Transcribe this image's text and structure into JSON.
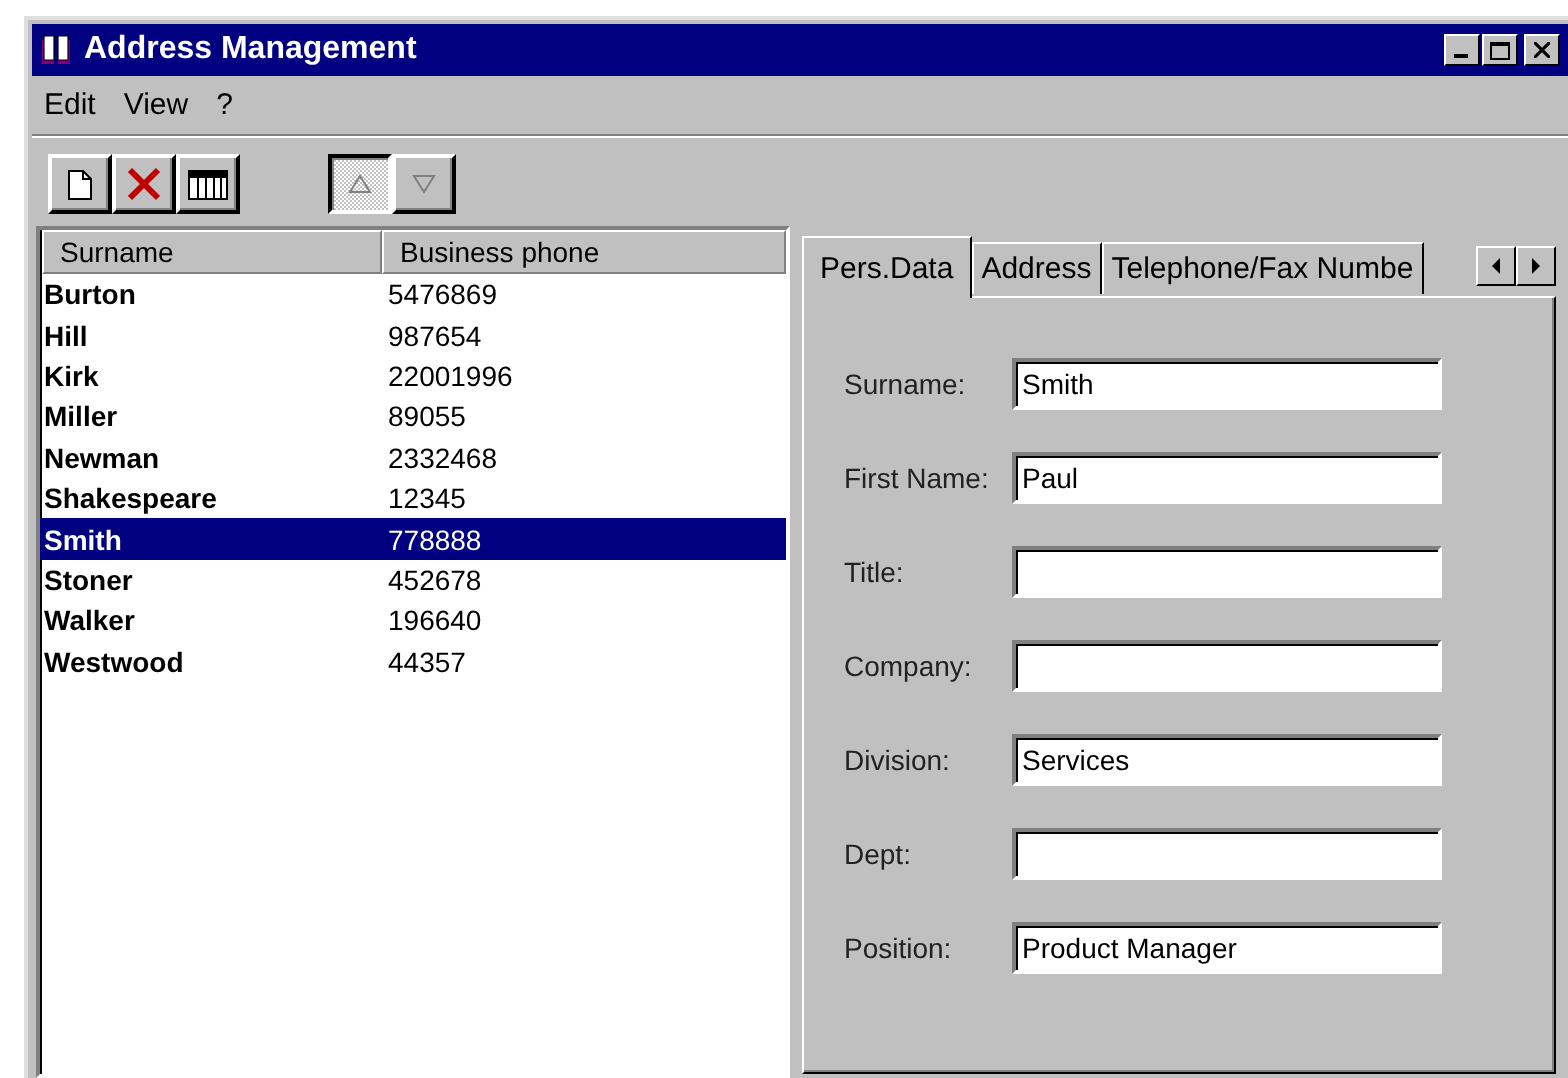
{
  "window": {
    "title": "Address Management"
  },
  "menu": [
    {
      "label": "Edit"
    },
    {
      "label": "View"
    },
    {
      "label": "?"
    }
  ],
  "toolbar": [
    {
      "kind": "new",
      "pressed": false,
      "disabled": false
    },
    {
      "kind": "delete",
      "pressed": false,
      "disabled": false
    },
    {
      "kind": "columns",
      "pressed": false,
      "disabled": false
    },
    {
      "kind": "sort-up",
      "pressed": true,
      "disabled": true
    },
    {
      "kind": "sort-down",
      "pressed": false,
      "disabled": true
    }
  ],
  "table": {
    "columns": [
      "Surname",
      "Business phone"
    ],
    "rows": [
      {
        "surname": "Burton",
        "phone": "5476869",
        "selected": false
      },
      {
        "surname": "Hill",
        "phone": "987654",
        "selected": false
      },
      {
        "surname": "Kirk",
        "phone": "22001996",
        "selected": false
      },
      {
        "surname": "Miller",
        "phone": "89055",
        "selected": false
      },
      {
        "surname": "Newman",
        "phone": "2332468",
        "selected": false
      },
      {
        "surname": "Shakespeare",
        "phone": "12345",
        "selected": false
      },
      {
        "surname": "Smith",
        "phone": "778888",
        "selected": true
      },
      {
        "surname": "Stoner",
        "phone": "452678",
        "selected": false
      },
      {
        "surname": "Walker",
        "phone": "196640",
        "selected": false
      },
      {
        "surname": "Westwood",
        "phone": "44357",
        "selected": false
      }
    ]
  },
  "tabs": [
    {
      "label": "Pers.Data",
      "selected": true
    },
    {
      "label": "Address",
      "selected": false
    },
    {
      "label": "Telephone/Fax Numbe",
      "selected": false
    }
  ],
  "form": [
    {
      "label": "Surname:",
      "value": "Smith"
    },
    {
      "label": "First Name:",
      "value": "Paul"
    },
    {
      "label": "Title:"
    },
    {
      "label": "Company:"
    },
    {
      "label": "Division:",
      "value": "Services"
    },
    {
      "label": "Dept:"
    },
    {
      "label": "Position:",
      "value": "Product Manager"
    }
  ]
}
